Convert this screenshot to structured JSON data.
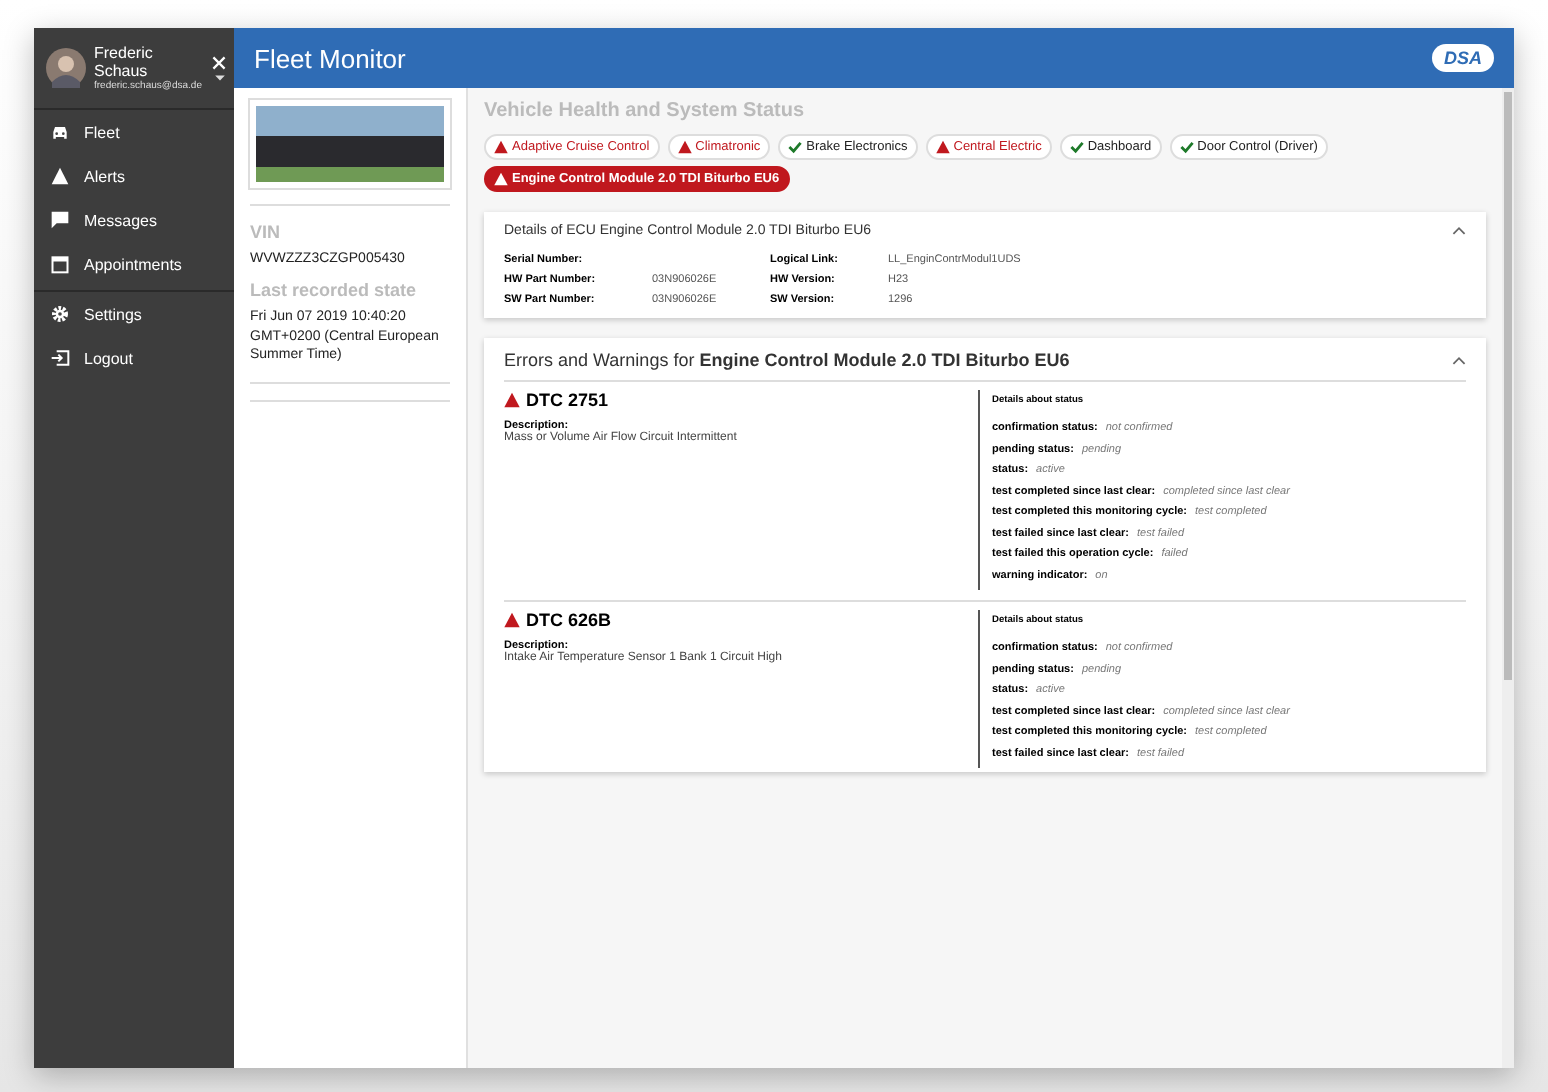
{
  "sidebar": {
    "user": {
      "name": "Frederic Schaus",
      "email": "frederic.schaus@dsa.de"
    },
    "items": [
      {
        "label": "Fleet",
        "group_start": false
      },
      {
        "label": "Alerts",
        "group_start": false
      },
      {
        "label": "Messages",
        "group_start": false
      },
      {
        "label": "Appointments",
        "group_start": false
      },
      {
        "label": "Settings",
        "group_start": true
      },
      {
        "label": "Logout",
        "group_start": false
      }
    ]
  },
  "header": {
    "title": "Fleet Monitor",
    "logo": "DSA"
  },
  "vehicle": {
    "vin_label": "VIN",
    "vin": "WVWZZZ3CZGP005430",
    "state_label": "Last recorded state",
    "state": "Fri Jun 07 2019 10:40:20 GMT+0200 (Central European Summer Time)"
  },
  "health": {
    "title": "Vehicle Health and System Status",
    "chips": [
      {
        "label": "Adaptive Cruise Control",
        "kind": "warning",
        "selected": false
      },
      {
        "label": "Climatronic",
        "kind": "warning",
        "selected": false
      },
      {
        "label": "Brake Electronics",
        "kind": "ok",
        "selected": false
      },
      {
        "label": "Central Electric",
        "kind": "warning",
        "selected": false
      },
      {
        "label": "Dashboard",
        "kind": "ok",
        "selected": false
      },
      {
        "label": "Door Control (Driver)",
        "kind": "ok",
        "selected": false
      },
      {
        "label": "Engine Control Module 2.0 TDI Biturbo EU6",
        "kind": "warning",
        "selected": true
      }
    ]
  },
  "details": {
    "title": "Details of ECU Engine Control Module 2.0 TDI Biturbo EU6",
    "expanded": true,
    "fields": [
      {
        "label": "Serial Number:"
      },
      {
        "label": "Logical Link:",
        "value": "LL_EnginContrModul1UDS"
      },
      {
        "label": "HW Part Number:",
        "value": "03N906026E"
      },
      {
        "label": "HW Version:",
        "value": "H23"
      },
      {
        "label": "SW Part Number:",
        "value": "03N906026E"
      },
      {
        "label": "SW Version:",
        "value": "1296"
      }
    ]
  },
  "errors": {
    "title": "Errors and Warnings for **Engine Control Module 2.0 TDI Biturbo EU6**",
    "expanded": true,
    "dtcs": [
      {
        "code": "DTC 2751",
        "description_label": "Description:",
        "description": "Mass or Volume Air Flow Circuit Intermittent",
        "status_title": "Details about status",
        "statuses": [
          {
            "label": "confirmation status:",
            "value": "not confirmed"
          },
          {
            "label": "pending status:",
            "value": "pending"
          },
          {
            "label": "status:",
            "value": "active"
          },
          {
            "label": "test completed since last clear:",
            "value": "completed since last clear"
          },
          {
            "label": "test completed this monitoring cycle:",
            "value": "test completed"
          },
          {
            "label": "test failed since last clear:",
            "value": "test failed"
          },
          {
            "label": "test failed this operation cycle:",
            "value": "failed"
          },
          {
            "label": "warning indicator:",
            "value": "on"
          }
        ]
      },
      {
        "code": "DTC 626B",
        "description_label": "Description:",
        "description": "Intake Air Temperature Sensor 1 Bank 1 Circuit High",
        "status_title": "Details about status",
        "statuses": [
          {
            "label": "confirmation status:",
            "value": "not confirmed"
          },
          {
            "label": "pending status:",
            "value": "pending"
          },
          {
            "label": "status:",
            "value": "active"
          },
          {
            "label": "test completed since last clear:",
            "value": "completed since last clear"
          },
          {
            "label": "test completed this monitoring cycle:",
            "value": "test completed"
          },
          {
            "label": "test failed since last clear:",
            "value": "test failed"
          }
        ]
      }
    ]
  }
}
